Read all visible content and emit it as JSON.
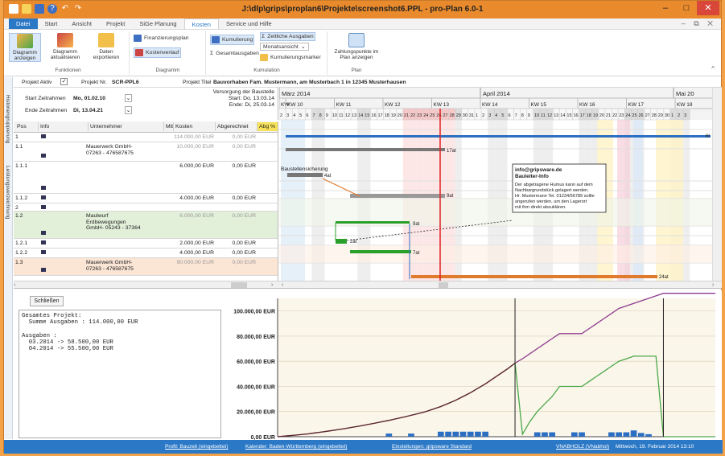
{
  "window": {
    "title": "J:\\dlp\\grips\\proplan6\\Projekte\\screenshot6.PPL - pro-Plan 6.0-1"
  },
  "tabs": [
    "Datei",
    "Start",
    "Ansicht",
    "Projekt",
    "SiGe Planung",
    "Kosten",
    "Service und Hilfe"
  ],
  "active_tab": "Kosten",
  "ribbon": {
    "funktionen": {
      "label": "Funktionen",
      "buttons": [
        "Diagramm anzeigen",
        "Diagramm aktualisieren",
        "Daten exportieren"
      ]
    },
    "diagramm": {
      "label": "Diagramm",
      "finanz": "Finanzierungsplan",
      "kostenverlauf": "Kostenverlauf"
    },
    "kumulation": {
      "label": "Kumulation",
      "kumulierung": "Kumulierung",
      "gesamtausgaben": "Gesamtausgaben",
      "zeitliche": "Zeitliche Ausgaben",
      "monatsansicht": "Monatsansicht",
      "kumulierungsmarker": "Kumulierungsmarker"
    },
    "plan": {
      "label": "Plan",
      "zahlung": "Zahlungspunkte im Plan anzeigen"
    }
  },
  "side_labels": [
    "Historiengruppierung",
    "Leistungsverzeichnung"
  ],
  "project": {
    "aktiv_label": "Projekt Aktiv",
    "nr_label": "Projekt Nr.",
    "nr": "SCR-PPL6",
    "titel_label": "Projekt Titel",
    "titel": "Bauvorhaben Fam. Mustermann, am Musterbach 1 in 12345 Musterhausen",
    "start_label": "Start Zeitrahmen",
    "start": "Mo, 01.02.10",
    "ende_label": "Ende Zeitrahmen",
    "ende": "Di, 13.04.21",
    "versorgung": "Versorgung der Baustelle",
    "v_start": "Start: Do, 13.03.14",
    "v_ende": "Ende: Di, 25.03.14"
  },
  "table": {
    "columns": [
      "Pos",
      "Info",
      "Unternehmer",
      "Mit",
      "Kosten",
      "Abgerechnet",
      "Abg %"
    ],
    "rows": [
      {
        "pos": "1",
        "unternehmer": "",
        "kosten": "114.000,00 EUR",
        "abg": "0,00 EUR",
        "style": "grey"
      },
      {
        "pos": "1.1",
        "unternehmer": "Mauerwerk GmbH-\n07263 - 476587675",
        "kosten": "10.000,00 EUR",
        "abg": "0,00 EUR",
        "style": "grey"
      },
      {
        "pos": "1.1.1",
        "unternehmer": "",
        "kosten": "6.000,00 EUR",
        "abg": "0,00 EUR",
        "style": "norm"
      },
      {
        "pos": "1.1.2",
        "unternehmer": "",
        "kosten": "4.000,00 EUR",
        "abg": "0,00 EUR",
        "style": "norm"
      },
      {
        "pos": "2",
        "unternehmer": "",
        "kosten": "",
        "abg": "",
        "style": "norm"
      },
      {
        "pos": "1.2",
        "unternehmer": "Maulwurf\nErdbewegungen\nGmbH- 05243 - 37364",
        "kosten": "6.000,00 EUR",
        "abg": "0,00 EUR",
        "style": "green"
      },
      {
        "pos": "1.2.1",
        "unternehmer": "",
        "kosten": "2.000,00 EUR",
        "abg": "0,00 EUR",
        "style": "norm"
      },
      {
        "pos": "1.2.2",
        "unternehmer": "",
        "kosten": "4.000,00 EUR",
        "abg": "0,00 EUR",
        "style": "norm"
      },
      {
        "pos": "1.3",
        "unternehmer": "Mauerwerk GmbH-\n07263 - 476587675",
        "kosten": "90.000,00 EUR",
        "abg": "0,00 EUR",
        "style": "orange"
      }
    ]
  },
  "gantt": {
    "months": [
      "März 2014",
      "April 2014",
      "Mai 20"
    ],
    "weeks": [
      "KW",
      "KW 10",
      "KW 11",
      "KW 12",
      "KW 13",
      "KW 14",
      "KW 15",
      "KW 16",
      "KW 17",
      "KW 18"
    ],
    "days": [
      "2",
      "3",
      "4",
      "5",
      "6",
      "7",
      "8",
      "9",
      "10",
      "11",
      "12",
      "13",
      "14",
      "15",
      "16",
      "17",
      "18",
      "19",
      "20",
      "21",
      "22",
      "23",
      "24",
      "25",
      "26",
      "27",
      "28",
      "29",
      "30",
      "31",
      "1",
      "2",
      "3",
      "4",
      "5",
      "6",
      "7",
      "8",
      "9",
      "10",
      "11",
      "12",
      "13",
      "14",
      "15",
      "16",
      "17",
      "18",
      "19",
      "20",
      "21",
      "22",
      "23",
      "24",
      "25",
      "26",
      "27",
      "28",
      "29",
      "30",
      "1",
      "2",
      "3"
    ],
    "bar_labels": [
      "6t",
      "17at",
      "4at",
      "9at",
      "9at",
      "2at",
      "7at",
      "24at"
    ],
    "task_label": "Baustellensicherung",
    "note": {
      "title": "info@gripsware.de",
      "subtitle": "Bauleiter-Info",
      "body": [
        "Der abgetragene Humus kann auf dem",
        "Nachbargrundstück gelagert werden.",
        "Hr. Mustermann Tel. 01234/56789 sollte",
        "angerufen werden, um den Lagerort",
        "mit ihm direkt abzuklären."
      ]
    }
  },
  "lower": {
    "close": "Schließen",
    "text": "Gesamtes Projekt:\n  Summe Ausgaben : 114.000,00 EUR\n\nAusgaben :\n  03.2014 -> 58.500,00 EUR\n  04.2014 -> 55.500,00 EUR"
  },
  "chart_data": {
    "type": "line",
    "ylim": [
      0,
      110000
    ],
    "y_ticks": [
      "0,00 EUR",
      "20.000,00 EUR",
      "40.000,00 EUR",
      "60.000,00 EUR",
      "80.000,00 EUR",
      "100.000,00 EUR"
    ],
    "y_tick_values": [
      0,
      20000,
      40000,
      60000,
      80000,
      100000
    ],
    "x_count": 60,
    "series": [
      {
        "color": "#8e3a8e",
        "values": [
          0,
          500,
          1000,
          1600,
          2200,
          3000,
          3800,
          4600,
          5500,
          6400,
          7400,
          8400,
          9500,
          10600,
          11800,
          13000,
          14300,
          15600,
          17000,
          18500,
          20000,
          22000,
          24000,
          26500,
          29000,
          32000,
          35000,
          38500,
          42000,
          46000,
          50000,
          54000,
          58500,
          62000,
          66000,
          70000,
          74000,
          78000,
          82000,
          82000,
          82000,
          82000,
          86000,
          90000,
          94000,
          98000,
          102000,
          104000,
          106000,
          108000,
          110000,
          112000,
          114000,
          114000,
          114000,
          114000,
          114000,
          114000,
          114000,
          114000
        ]
      },
      {
        "color": "#5a2a2a",
        "values": [
          0,
          500,
          1000,
          1600,
          2200,
          3000,
          3800,
          4600,
          5500,
          6400,
          7400,
          8400,
          9500,
          10600,
          11800,
          13000,
          14300,
          15600,
          17000,
          18500,
          20000,
          22000,
          24000,
          26500,
          29000,
          32000,
          35000,
          38500,
          42000,
          46000,
          50000,
          54000,
          58500
        ]
      },
      {
        "color": "#4aa84a",
        "values": [
          null,
          null,
          null,
          null,
          null,
          null,
          null,
          null,
          null,
          null,
          null,
          null,
          null,
          null,
          null,
          null,
          null,
          null,
          null,
          null,
          null,
          null,
          null,
          null,
          null,
          null,
          null,
          null,
          null,
          null,
          null,
          null,
          58500,
          2000,
          12000,
          20000,
          26000,
          32000,
          40000,
          40000,
          40000,
          40000,
          44000,
          48000,
          52000,
          56000,
          60000,
          62000,
          64000,
          64000,
          64000,
          64000,
          0,
          0,
          0,
          0,
          0,
          0,
          0,
          0
        ]
      }
    ],
    "bars": [
      0,
      0,
      0,
      0,
      0,
      0,
      0,
      0,
      0,
      0,
      0,
      0,
      0,
      0,
      0,
      2500,
      0,
      0,
      2500,
      0,
      0,
      0,
      4000,
      4000,
      4000,
      4000,
      4000,
      4000,
      4000,
      0,
      0,
      0,
      0,
      0,
      0,
      3500,
      3500,
      3500,
      0,
      0,
      3500,
      3500,
      0,
      0,
      0,
      3500,
      3500,
      3500,
      5000,
      3000,
      2000,
      0,
      0,
      0,
      0,
      0,
      0,
      0,
      0,
      0
    ],
    "bar_color": "#2c6fc2",
    "markers": [
      32,
      52
    ]
  },
  "status": {
    "profil": "Profil: Bauzeit (eingebettet)",
    "kalender": "Kalender: Baden-Württemberg (eingebettet)",
    "einstellungen": "Einstellungen: gripsware Standard",
    "user": "VNABHOLZ (VNabhol)",
    "date": "Mittwoch, 19. Februar 2014 13:10"
  }
}
